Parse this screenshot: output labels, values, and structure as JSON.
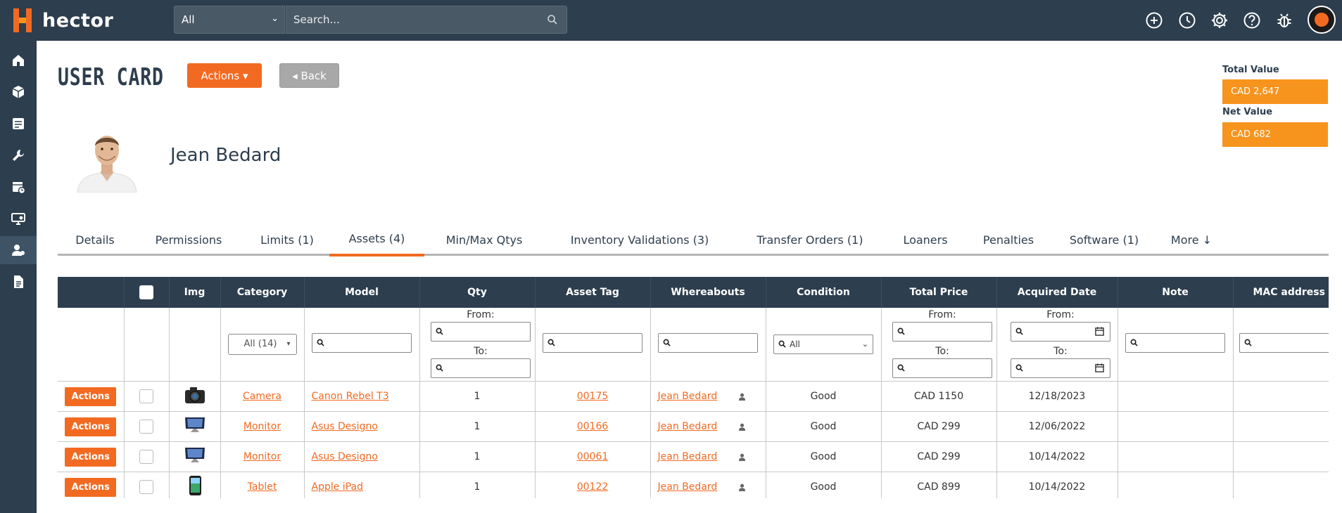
{
  "brand": {
    "name": "hector",
    "accent": "#f26a21",
    "nav_bg": "#2d3e4e",
    "value_color": "#f7941d"
  },
  "topbar": {
    "scope_value": "All",
    "search_placeholder": "Search...",
    "icons": [
      "plus-circle-icon",
      "clock-icon",
      "gear-icon",
      "help-circle-icon",
      "bug-icon",
      "user-avatar"
    ]
  },
  "sidebar": {
    "items": [
      {
        "icon": "home-icon"
      },
      {
        "icon": "boxes-icon"
      },
      {
        "icon": "clipboard-list-icon"
      },
      {
        "icon": "wrench-icon"
      },
      {
        "icon": "calendar-clock-icon"
      },
      {
        "icon": "monitor-settings-icon"
      },
      {
        "icon": "user-card-icon",
        "active": true
      },
      {
        "icon": "document-icon"
      }
    ]
  },
  "header": {
    "title": "USER CARD",
    "actions_label": "Actions ▾",
    "back_label": "◂ Back"
  },
  "values": {
    "total_label": "Total Value",
    "total_value": "CAD 2,647",
    "net_label": "Net Value",
    "net_value": "CAD 682"
  },
  "profile": {
    "name": "Jean Bedard"
  },
  "tabs": [
    {
      "label": "Details"
    },
    {
      "label": "Permissions"
    },
    {
      "label": "Limits (1)"
    },
    {
      "label": "Assets (4)",
      "active": true
    },
    {
      "label": "Min/Max Qtys"
    },
    {
      "label": "Inventory Validations (3)"
    },
    {
      "label": "Transfer Orders (1)"
    },
    {
      "label": "Loaners"
    },
    {
      "label": "Penalties"
    },
    {
      "label": "Software (1)"
    },
    {
      "label": "More ↓"
    }
  ],
  "table": {
    "columns": [
      "",
      "",
      "Img",
      "Category",
      "Model",
      "Qty",
      "Asset Tag",
      "Whereabouts",
      "Condition",
      "Total Price",
      "Acquired Date",
      "Note",
      "MAC address"
    ],
    "filters": {
      "category": "All (14)",
      "condition": "All",
      "from_label": "From:",
      "to_label": "To:"
    },
    "row_action_label": "Actions",
    "rows": [
      {
        "img": "camera",
        "category": "Camera",
        "model": "Canon Rebel T3",
        "qty": "1",
        "tag": "00175",
        "whereabouts": "Jean Bedard",
        "condition": "Good",
        "price": "CAD 1150",
        "date": "12/18/2023",
        "note": "",
        "mac": ""
      },
      {
        "img": "monitor",
        "category": "Monitor",
        "model": "Asus Designo",
        "qty": "1",
        "tag": "00166",
        "whereabouts": "Jean Bedard",
        "condition": "Good",
        "price": "CAD 299",
        "date": "12/06/2022",
        "note": "",
        "mac": ""
      },
      {
        "img": "monitor",
        "category": "Monitor",
        "model": "Asus Designo",
        "qty": "1",
        "tag": "00061",
        "whereabouts": "Jean Bedard",
        "condition": "Good",
        "price": "CAD 299",
        "date": "10/14/2022",
        "note": "",
        "mac": ""
      },
      {
        "img": "tablet",
        "category": "Tablet",
        "model": "Apple iPad",
        "qty": "1",
        "tag": "00122",
        "whereabouts": "Jean Bedard",
        "condition": "Good",
        "price": "CAD 899",
        "date": "10/14/2022",
        "note": "",
        "mac": ""
      }
    ]
  }
}
